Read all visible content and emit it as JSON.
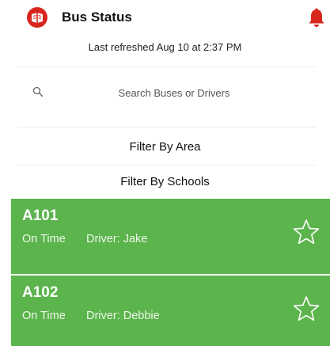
{
  "header": {
    "title": "Bus Status"
  },
  "refresh": {
    "text": "Last refreshed Aug 10 at 2:37 PM"
  },
  "search": {
    "placeholder": "Search Buses or Drivers"
  },
  "filters": {
    "area": "Filter By Area",
    "schools": "Filter By Schools"
  },
  "buses": [
    {
      "id": "A101",
      "status": "On Time",
      "driver": "Driver: Jake"
    },
    {
      "id": "A102",
      "status": "On Time",
      "driver": "Driver: Debbie"
    }
  ],
  "icons": {
    "logo": "app-logo-icon",
    "bell": "bell-icon",
    "search": "search-icon",
    "star": "star-outline-icon"
  },
  "colors": {
    "brand_red": "#d7261e",
    "card_green": "#5cb44c"
  }
}
